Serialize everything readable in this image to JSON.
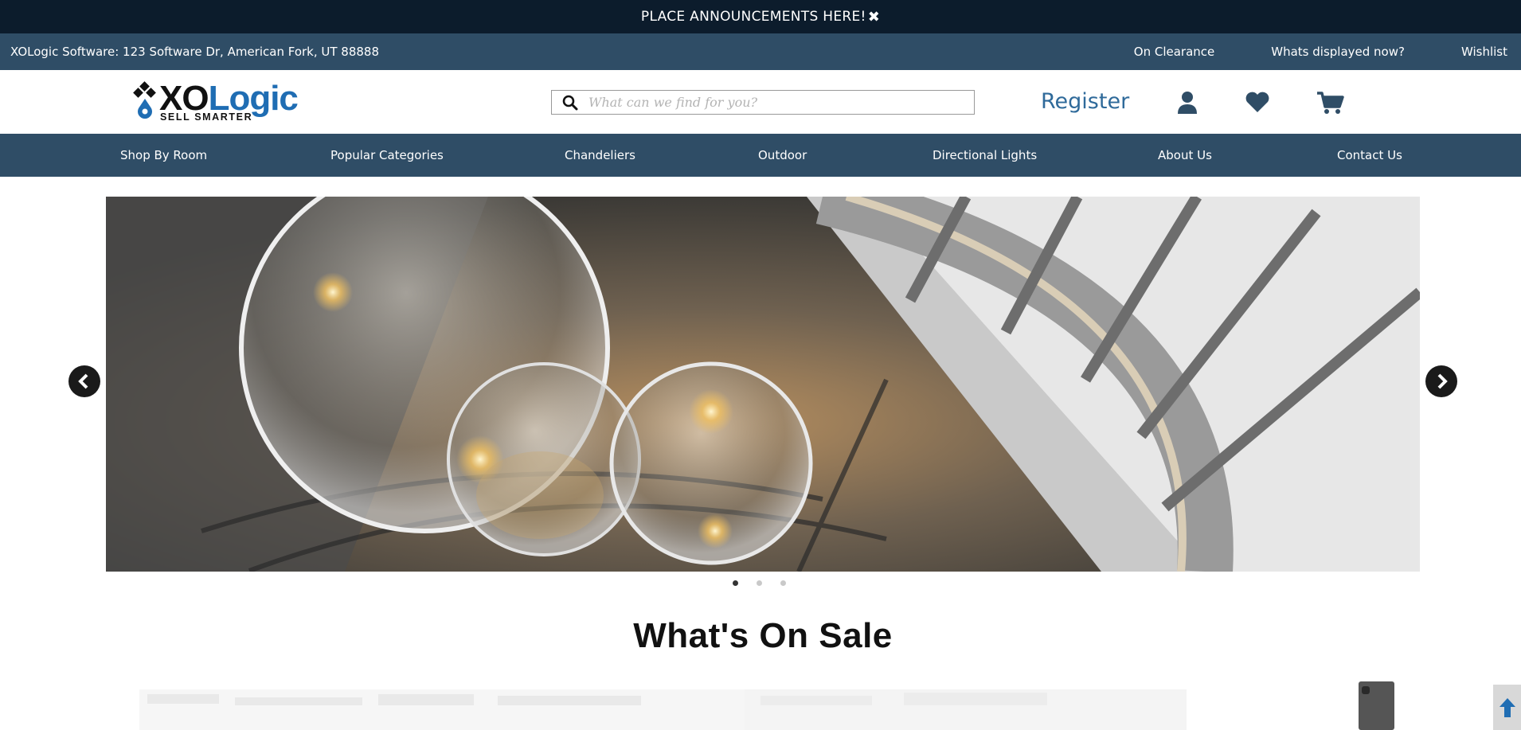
{
  "announcement": {
    "text": "PLACE ANNOUNCEMENTS HERE!",
    "close_glyph": "✖"
  },
  "topbar": {
    "address": "XOLogic Software: 123 Software Dr, American Fork, UT 88888",
    "links": [
      "On Clearance",
      "Whats displayed now?",
      "Wishlist"
    ]
  },
  "header": {
    "logo": {
      "text_xo": "XO",
      "text_logic": "Logic",
      "tagline": "SELL SMARTER"
    },
    "search": {
      "placeholder": "What can we find for you?",
      "value": ""
    },
    "register_label": "Register",
    "icons": [
      "user-icon",
      "heart-icon",
      "cart-icon"
    ]
  },
  "nav": {
    "items": [
      "Shop By Room",
      "Popular Categories",
      "Chandeliers",
      "Outdoor",
      "Directional Lights",
      "About Us",
      "Contact Us"
    ]
  },
  "carousel": {
    "slide_count": 3,
    "active_slide": 1
  },
  "section": {
    "title": "What's On Sale"
  },
  "colors": {
    "announcement_bg": "#0c1c2c",
    "bar_bg": "#2f4d66",
    "brand_blue": "#1f6db3",
    "register": "#2f6a9a"
  }
}
